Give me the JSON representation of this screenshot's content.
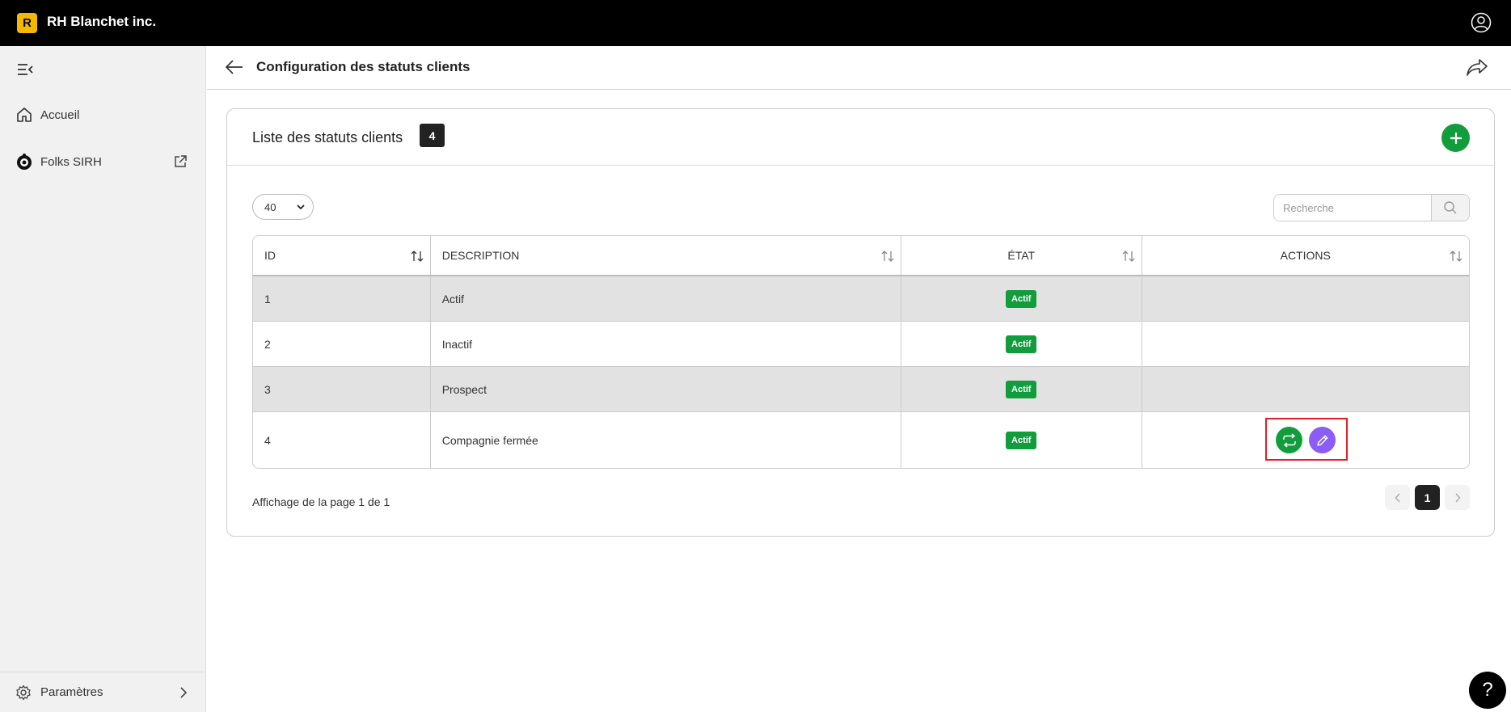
{
  "app": {
    "company_name": "RH Blanchet inc.",
    "logo_letter": "R"
  },
  "sidebar": {
    "items": [
      {
        "label": "Accueil",
        "icon": "home-icon"
      },
      {
        "label": "Folks SIRH",
        "icon": "folks-logo-icon",
        "external": true
      }
    ],
    "bottom": {
      "label": "Paramètres",
      "icon": "gear-icon"
    }
  },
  "header": {
    "title": "Configuration des statuts clients"
  },
  "card": {
    "title": "Liste des statuts clients",
    "count": "4",
    "page_size": "40",
    "search_placeholder": "Recherche"
  },
  "table": {
    "columns": [
      "ID",
      "DESCRIPTION",
      "ÉTAT",
      "ACTIONS"
    ],
    "rows": [
      {
        "id": "1",
        "description": "Actif",
        "etat": "Actif"
      },
      {
        "id": "2",
        "description": "Inactif",
        "etat": "Actif"
      },
      {
        "id": "3",
        "description": "Prospect",
        "etat": "Actif"
      },
      {
        "id": "4",
        "description": "Compagnie fermée",
        "etat": "Actif"
      }
    ]
  },
  "footer": {
    "page_info": "Affichage de la page 1 de 1",
    "current_page": "1"
  },
  "help": {
    "label": "?"
  },
  "colors": {
    "accent_green": "#129d3d",
    "edit_purple": "#8b5cf6",
    "highlight_red": "#e31e24"
  }
}
